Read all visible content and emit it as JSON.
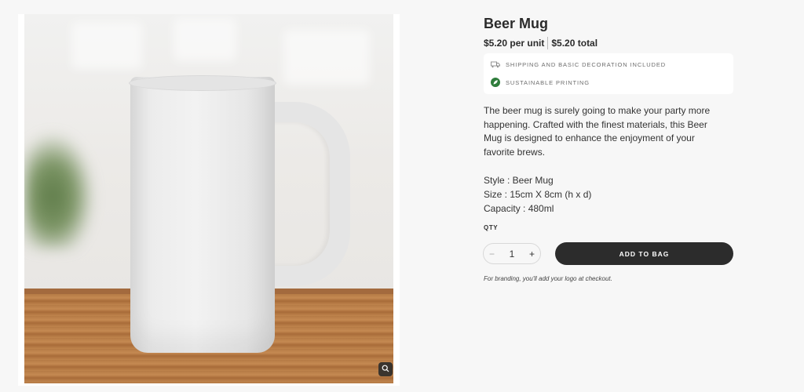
{
  "product": {
    "title": "Beer Mug",
    "unit_price": "$5.20 per unit",
    "total_price": "$5.20 total"
  },
  "info": {
    "shipping": "SHIPPING AND BASIC DECORATION INCLUDED",
    "sustainable": "SUSTAINABLE PRINTING"
  },
  "description": "The beer mug is surely going to make your party more happening. Crafted with the finest materials, this Beer Mug is designed to enhance the enjoyment of your favorite brews.",
  "specs": {
    "style": "Style : Beer Mug",
    "size": "Size : 15cm X 8cm (h x d)",
    "capacity": "Capacity : 480ml"
  },
  "quantity": {
    "label": "QTY",
    "value": "1",
    "minus": "−",
    "plus": "+"
  },
  "add_to_bag": "ADD TO BAG",
  "branding_note": "For branding, you'll add your logo at checkout.",
  "icons": {
    "shipping": "truck-icon",
    "sustainable": "leaf-icon",
    "zoom": "zoom-icon"
  },
  "colors": {
    "accent_dark": "#2c2c2c",
    "leaf_green": "#2f7d3c"
  }
}
